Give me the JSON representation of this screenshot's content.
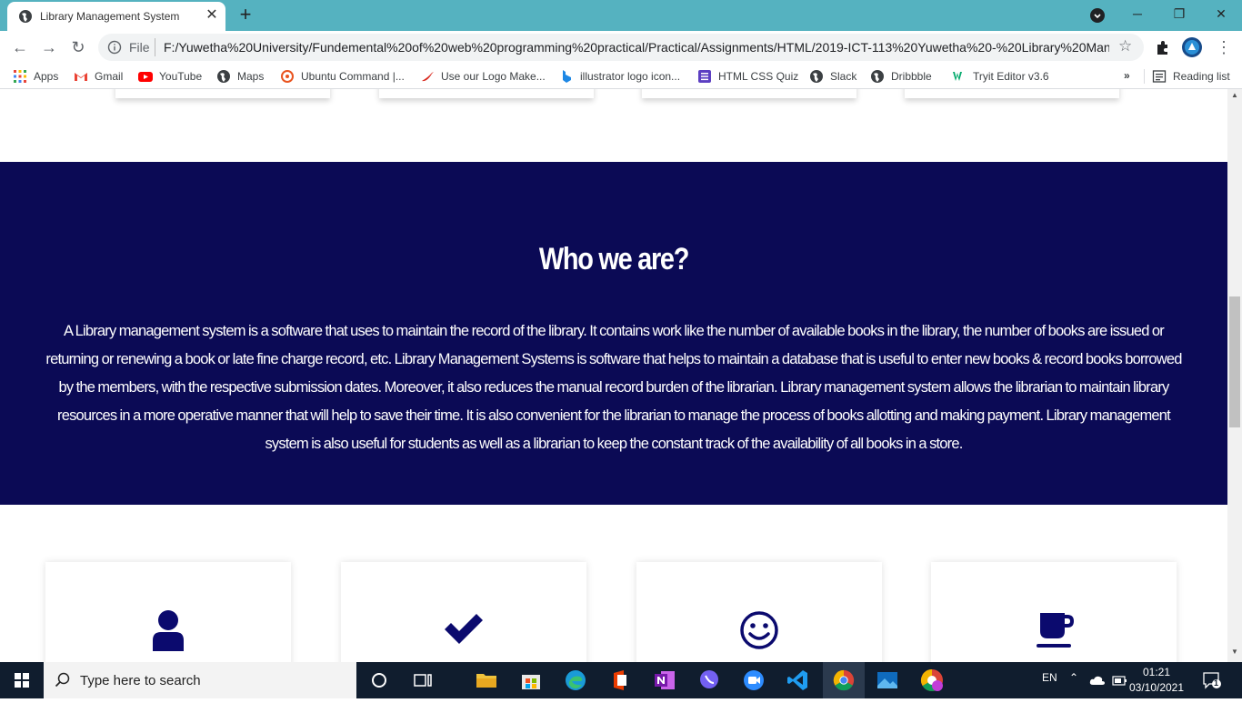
{
  "browser": {
    "tab_title": "Library Management System",
    "tab_close": "✕",
    "new_tab": "+",
    "window": {
      "minimize": "─",
      "restore": "❐",
      "close": "✕"
    },
    "omnibox": {
      "scheme_label": "File",
      "url": "F:/Yuwetha%20University/Fundemental%20of%20web%20programming%20practical/Practical/Assignments/HTML/2019-ICT-113%20Yuwetha%20-%20Library%20Man..."
    },
    "bookmarks": [
      {
        "label": "Apps",
        "icon": "apps-grid-icon"
      },
      {
        "label": "Gmail",
        "icon": "gmail-icon"
      },
      {
        "label": "YouTube",
        "icon": "youtube-icon"
      },
      {
        "label": "Maps",
        "icon": "globe-icon"
      },
      {
        "label": "Ubuntu Command |...",
        "icon": "ubuntu-icon"
      },
      {
        "label": "Use our Logo Make...",
        "icon": "chili-icon"
      },
      {
        "label": "illustrator logo icon...",
        "icon": "bing-icon"
      },
      {
        "label": "HTML CSS Quiz",
        "icon": "quiz-icon"
      },
      {
        "label": "Slack",
        "icon": "globe-icon"
      },
      {
        "label": "Dribbble",
        "icon": "globe-icon"
      },
      {
        "label": "Tryit Editor v3.6",
        "icon": "w3schools-icon"
      }
    ],
    "bookmarks_overflow": "»",
    "reading_list": "Reading list"
  },
  "page": {
    "heading": "Who we are?",
    "body": "A Library management system is a software that uses to maintain the record of the library. It contains work like the number of available books in the library, the number of books are issued or returning or renewing a book or late fine charge record, etc. Library Management Systems is software that helps to maintain a database that is useful to enter new books & record books borrowed by the members, with the respective submission dates. Moreover, it also reduces the manual record burden of the librarian. Library management system allows the librarian to maintain library resources in a more operative manner that will help to save their time. It is also convenient for the librarian to manage the process of books allotting and making payment. Library management system is also useful for students as well as a librarian to keep the constant track of the availability of all books in a store.",
    "feature_icons": [
      "user-icon",
      "check-icon",
      "smile-icon",
      "coffee-cup-icon"
    ]
  },
  "colors": {
    "hero_bg": "#0b0a55",
    "accent": "#0b0a6e",
    "chrome_frame": "#55b2c0"
  },
  "taskbar": {
    "search_placeholder": "Type here to search",
    "language": "EN",
    "time": "01:21",
    "date": "03/10/2021",
    "notification_count": "1"
  }
}
